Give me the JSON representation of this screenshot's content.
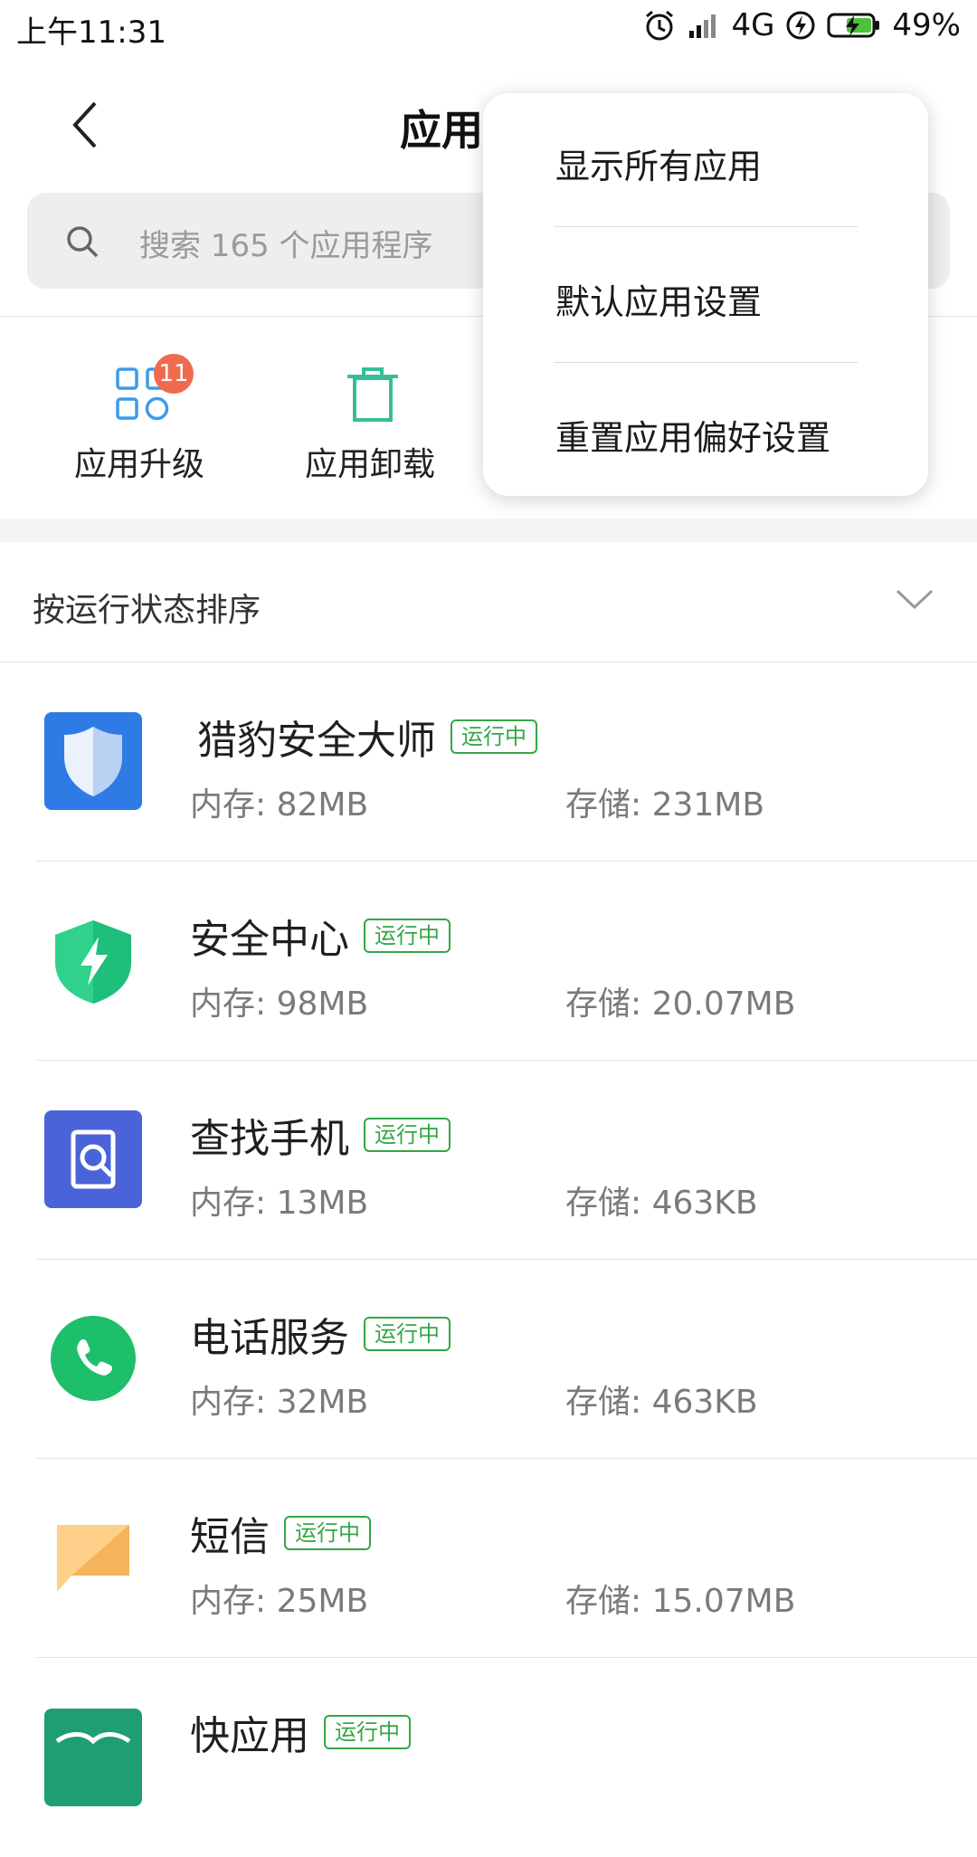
{
  "status_bar": {
    "time": "上午11:31",
    "network": "4G",
    "battery": "49%",
    "icons": [
      "alarm-icon",
      "signal-icon",
      "data-arrows-icon",
      "charging-bolt-icon",
      "battery-icon"
    ]
  },
  "header": {
    "title": "应用",
    "back_icon": "chevron-left-icon"
  },
  "search": {
    "placeholder": "搜索 165 个应用程序",
    "icon": "search-icon"
  },
  "quick_actions": [
    {
      "label": "应用升级",
      "icon": "apps-grid-icon",
      "badge": "11",
      "color": "#3d9be9"
    },
    {
      "label": "应用卸载",
      "icon": "trash-icon",
      "color": "#36bf97"
    }
  ],
  "sort": {
    "label": "按运行状态排序",
    "icon": "chevron-down-icon"
  },
  "running_label": "运行中",
  "apps": [
    {
      "name": "猎豹安全大师",
      "memory": "内存: 82MB",
      "storage": "存储: 231MB",
      "icon": "shield-app-icon"
    },
    {
      "name": "安全中心",
      "memory": "内存: 98MB",
      "storage": "存储: 20.07MB",
      "icon": "security-center-icon"
    },
    {
      "name": "查找手机",
      "memory": "内存: 13MB",
      "storage": "存储: 463KB",
      "icon": "find-phone-icon"
    },
    {
      "name": "电话服务",
      "memory": "内存: 32MB",
      "storage": "存储: 463KB",
      "icon": "phone-icon"
    },
    {
      "name": "短信",
      "memory": "内存: 25MB",
      "storage": "存储: 15.07MB",
      "icon": "message-icon"
    },
    {
      "name": "快应用",
      "icon": "quick-app-icon"
    }
  ],
  "popup_menu": {
    "items": [
      "显示所有应用",
      "默认应用设置",
      "重置应用偏好设置"
    ]
  },
  "colors": {
    "running_green": "#35a646",
    "badge_red": "#f06b4d"
  }
}
